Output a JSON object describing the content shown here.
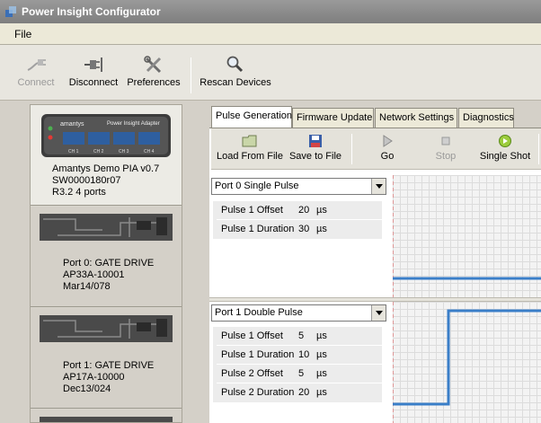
{
  "window": {
    "title": "Power Insight Configurator"
  },
  "menu": {
    "file": "File"
  },
  "toolbar": {
    "connect": "Connect",
    "disconnect": "Disconnect",
    "preferences": "Preferences",
    "rescan": "Rescan Devices"
  },
  "devices": [
    {
      "name": "Amantys Demo PIA  v0.7",
      "serial": "SW0000180r07",
      "info": "R3.2  4 ports",
      "board_brand": "amantys",
      "board_label": "Power Insight Adapter",
      "board_channels": [
        "CH 1",
        "CH 2",
        "CH 3",
        "CH 4"
      ]
    },
    {
      "label": "Port 0: GATE DRIVE",
      "part": "AP33A-10001",
      "date": "Mar14/078"
    },
    {
      "label": "Port 1: GATE DRIVE",
      "part": "AP17A-10000",
      "date": "Dec13/024"
    }
  ],
  "tabs": [
    "Pulse Generation",
    "Firmware Update",
    "Network Settings",
    "Diagnostics"
  ],
  "actions": {
    "load": "Load From File",
    "save": "Save to File",
    "go": "Go",
    "stop": "Stop",
    "single_shot": "Single Shot"
  },
  "ports": [
    {
      "mode": "Port 0 Single Pulse",
      "params": [
        {
          "name": "Pulse 1 Offset",
          "value": "20",
          "unit": "µs"
        },
        {
          "name": "Pulse 1 Duration",
          "value": "30",
          "unit": "µs"
        }
      ]
    },
    {
      "mode": "Port 1 Double Pulse",
      "params": [
        {
          "name": "Pulse 1 Offset",
          "value": "5",
          "unit": "µs"
        },
        {
          "name": "Pulse 1 Duration",
          "value": "10",
          "unit": "µs"
        },
        {
          "name": "Pulse 2 Offset",
          "value": "5",
          "unit": "µs"
        },
        {
          "name": "Pulse 2 Duration",
          "value": "20",
          "unit": "µs"
        }
      ]
    }
  ],
  "colors": {
    "waveform": "#3a7ec8",
    "marker": "#e05050",
    "active_tab": "#ffffff"
  }
}
